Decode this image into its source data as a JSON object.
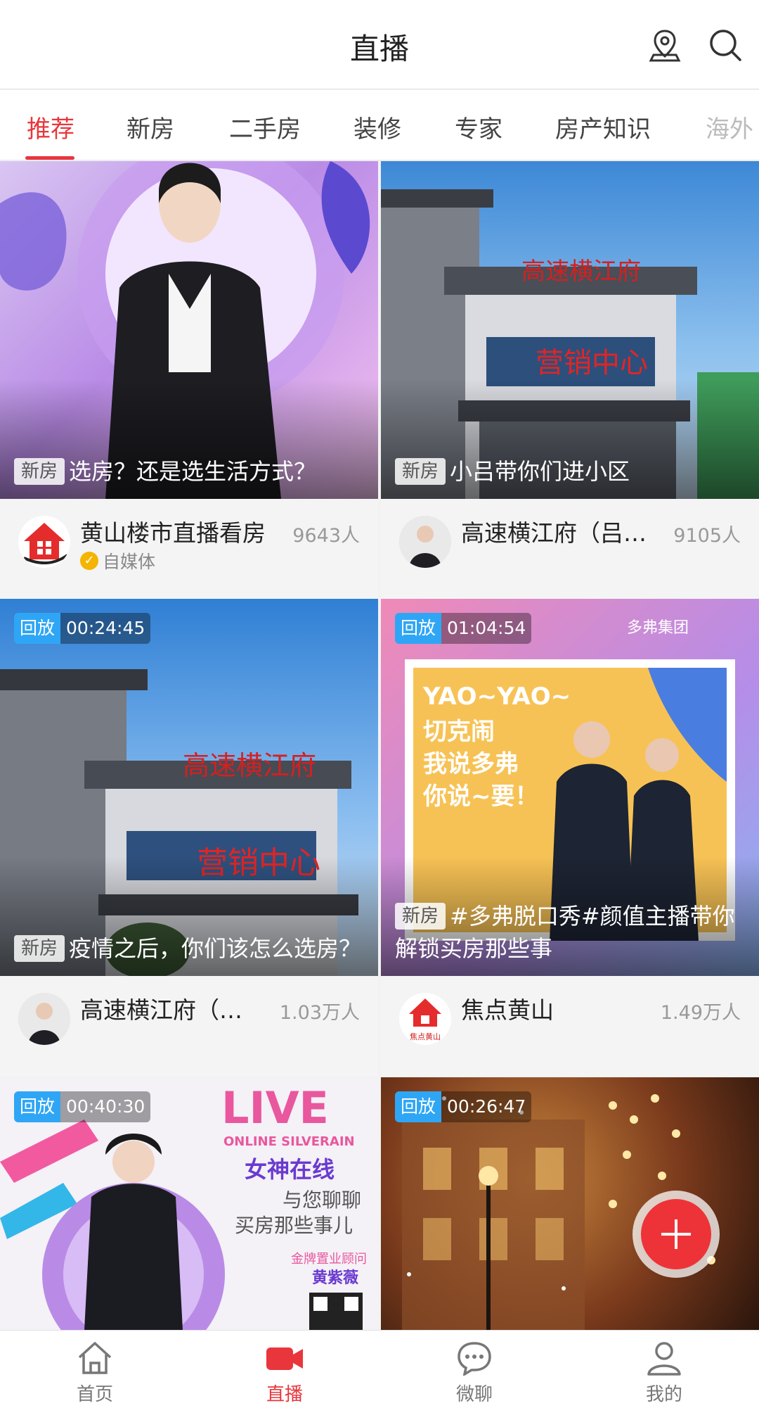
{
  "header": {
    "title": "直播"
  },
  "tabs": [
    {
      "label": "推荐",
      "active": true
    },
    {
      "label": "新房"
    },
    {
      "label": "二手房"
    },
    {
      "label": "装修"
    },
    {
      "label": "专家"
    },
    {
      "label": "房产知识"
    },
    {
      "label": "海外"
    }
  ],
  "cards": [
    {
      "tag": "新房",
      "title": "选房？还是选生活方式？",
      "anchor": "黄山楼市直播看房",
      "sub": "自媒体",
      "viewers": "9643人"
    },
    {
      "tag": "新房",
      "title": "小吕带你们进小区",
      "anchor": "高速横江府（吕…",
      "viewers": "9105人"
    },
    {
      "badge_kind": "回放",
      "badge_time": "00:24:45",
      "tag": "新房",
      "title": "疫情之后，你们该怎么选房？",
      "anchor": "高速横江府（…",
      "viewers": "1.03万人"
    },
    {
      "badge_kind": "回放",
      "badge_time": "01:04:54",
      "tag": "新房",
      "title": "#多弗脱口秀#颜值主播带你解锁买房那些事",
      "anchor": "焦点黄山",
      "viewers": "1.49万人"
    },
    {
      "badge_kind": "回放",
      "badge_time": "00:40:30"
    },
    {
      "badge_kind": "回放",
      "badge_time": "00:26:47"
    }
  ],
  "thumb_text": {
    "building_sign_top": "高速横江府",
    "building_sign_bottom": "营销中心",
    "poster_yao": "YAO~YAO~",
    "poster_line1": "切克闹",
    "poster_line2": "我说多弗",
    "poster_line3": "你说~要！",
    "poster_brand": "多弗集团",
    "live_word": "LIVE",
    "live_sub": "ONLINE SILVERAIN",
    "live_title": "女神在线",
    "live_line1": "与您聊聊",
    "live_line2": "买房那些事儿",
    "live_role": "金牌置业顾问",
    "live_person": "黄紫薇",
    "avatar_logo_text": "焦点黄山"
  },
  "bottom_nav": [
    {
      "label": "首页",
      "icon": "home-icon"
    },
    {
      "label": "直播",
      "icon": "video-camera-icon",
      "active": true
    },
    {
      "label": "微聊",
      "icon": "chat-bubble-icon"
    },
    {
      "label": "我的",
      "icon": "user-icon"
    }
  ],
  "colors": {
    "accent": "#e8363c",
    "badge_blue": "#2fa6f5",
    "fab": "#ee3338"
  }
}
